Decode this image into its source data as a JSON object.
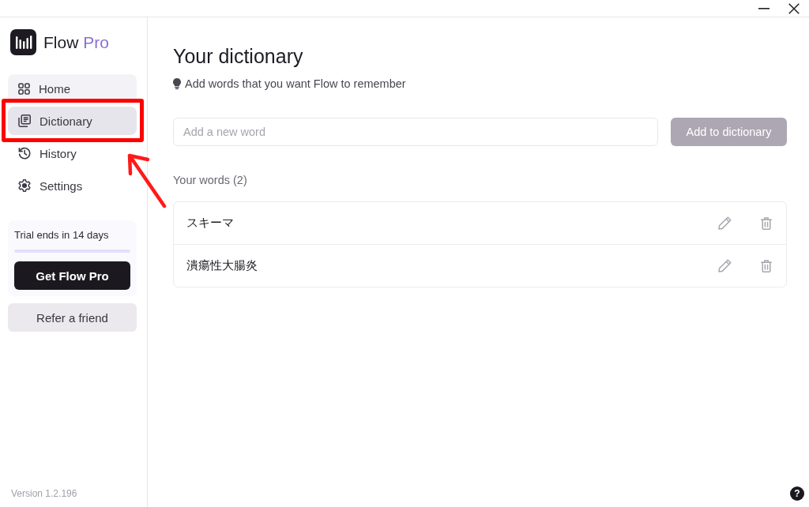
{
  "window": {
    "controls": [
      {
        "kind": "minimize"
      },
      {
        "kind": "close"
      }
    ]
  },
  "sidebar": {
    "brand": {
      "name": "Flow",
      "tier": "Pro"
    },
    "nav": [
      {
        "kind": "home",
        "label": "Home",
        "selected": false,
        "hovered": true,
        "callout": false
      },
      {
        "kind": "dictionary",
        "label": "Dictionary",
        "selected": true,
        "hovered": false,
        "callout": true
      },
      {
        "kind": "history",
        "label": "History",
        "selected": false,
        "hovered": false,
        "callout": false
      },
      {
        "kind": "settings",
        "label": "Settings",
        "selected": false,
        "hovered": false,
        "callout": false
      }
    ],
    "trial": {
      "text": "Trial ends in 14 days",
      "level": 1,
      "button": "Get Flow Pro"
    },
    "refer_button": "Refer a friend",
    "version": "Version 1.2.196"
  },
  "main": {
    "title": "Your dictionary",
    "hint": "Add words that you want Flow to remember",
    "new_word": {
      "placeholder": "Add a new word"
    },
    "add_button": {
      "label": "Add to dictionary",
      "disabled": true
    },
    "words_heading": "Your words (2)",
    "words": [
      {
        "text": "スキーマ"
      },
      {
        "text": "潰瘍性大腸炎"
      }
    ]
  },
  "help_button": {
    "label": "?"
  }
}
